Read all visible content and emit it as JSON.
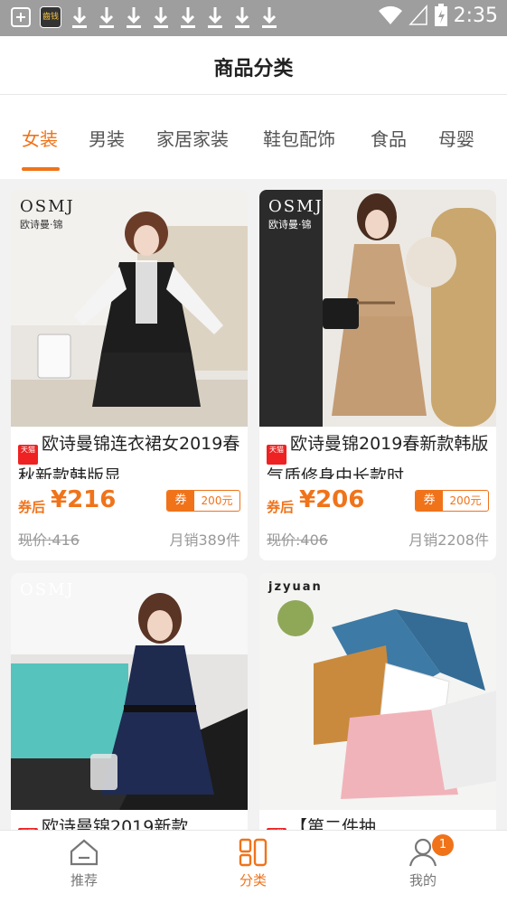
{
  "status_bar": {
    "time": "2:35",
    "app_icon_text": "齒钱"
  },
  "header": {
    "title": "商品分类"
  },
  "tabs": [
    {
      "label": "女装",
      "active": true
    },
    {
      "label": "男装",
      "active": false
    },
    {
      "label": "家居家装",
      "active": false
    },
    {
      "label": "鞋包配饰",
      "active": false
    },
    {
      "label": "食品",
      "active": false
    },
    {
      "label": "母婴",
      "active": false
    }
  ],
  "products": [
    {
      "brand": "OSMJ",
      "brand_sub": "欧诗曼·锦",
      "shop_badge": "天猫",
      "title": "欧诗曼锦连衣裙女2019春秋新款韩版显...",
      "price_label": "券后",
      "price": "¥216",
      "coupon_label": "券",
      "coupon_value": "200元",
      "original_price": "现价:416",
      "sales": "月销389件"
    },
    {
      "brand": "OSMJ",
      "brand_sub": "欧诗曼·锦",
      "shop_badge": "天猫",
      "title": "欧诗曼锦2019春新款韩版气质修身中长款时...",
      "price_label": "券后",
      "price": "¥206",
      "coupon_label": "券",
      "coupon_value": "200元",
      "original_price": "现价:406",
      "sales": "月销2208件"
    },
    {
      "brand": "OSMJ",
      "brand_sub": "",
      "shop_badge": "天猫",
      "title": "欧诗曼锦2019新款",
      "price_label": "",
      "price": "",
      "coupon_label": "",
      "coupon_value": "",
      "original_price": "",
      "sales": ""
    },
    {
      "brand": "jzyuan",
      "brand_sub": "",
      "shop_badge": "天猫",
      "title": "【第二件抽",
      "price_label": "",
      "price": "",
      "coupon_label": "",
      "coupon_value": "",
      "original_price": "",
      "sales": ""
    }
  ],
  "bottom_nav": [
    {
      "label": "推荐",
      "icon": "home-icon",
      "active": false
    },
    {
      "label": "分类",
      "icon": "category-icon",
      "active": true
    },
    {
      "label": "我的",
      "icon": "user-icon",
      "active": false,
      "badge": "1"
    }
  ],
  "colors": {
    "accent": "#f0731a",
    "status_bar": "#9e9e9e",
    "tmall_red": "#ee2222"
  }
}
